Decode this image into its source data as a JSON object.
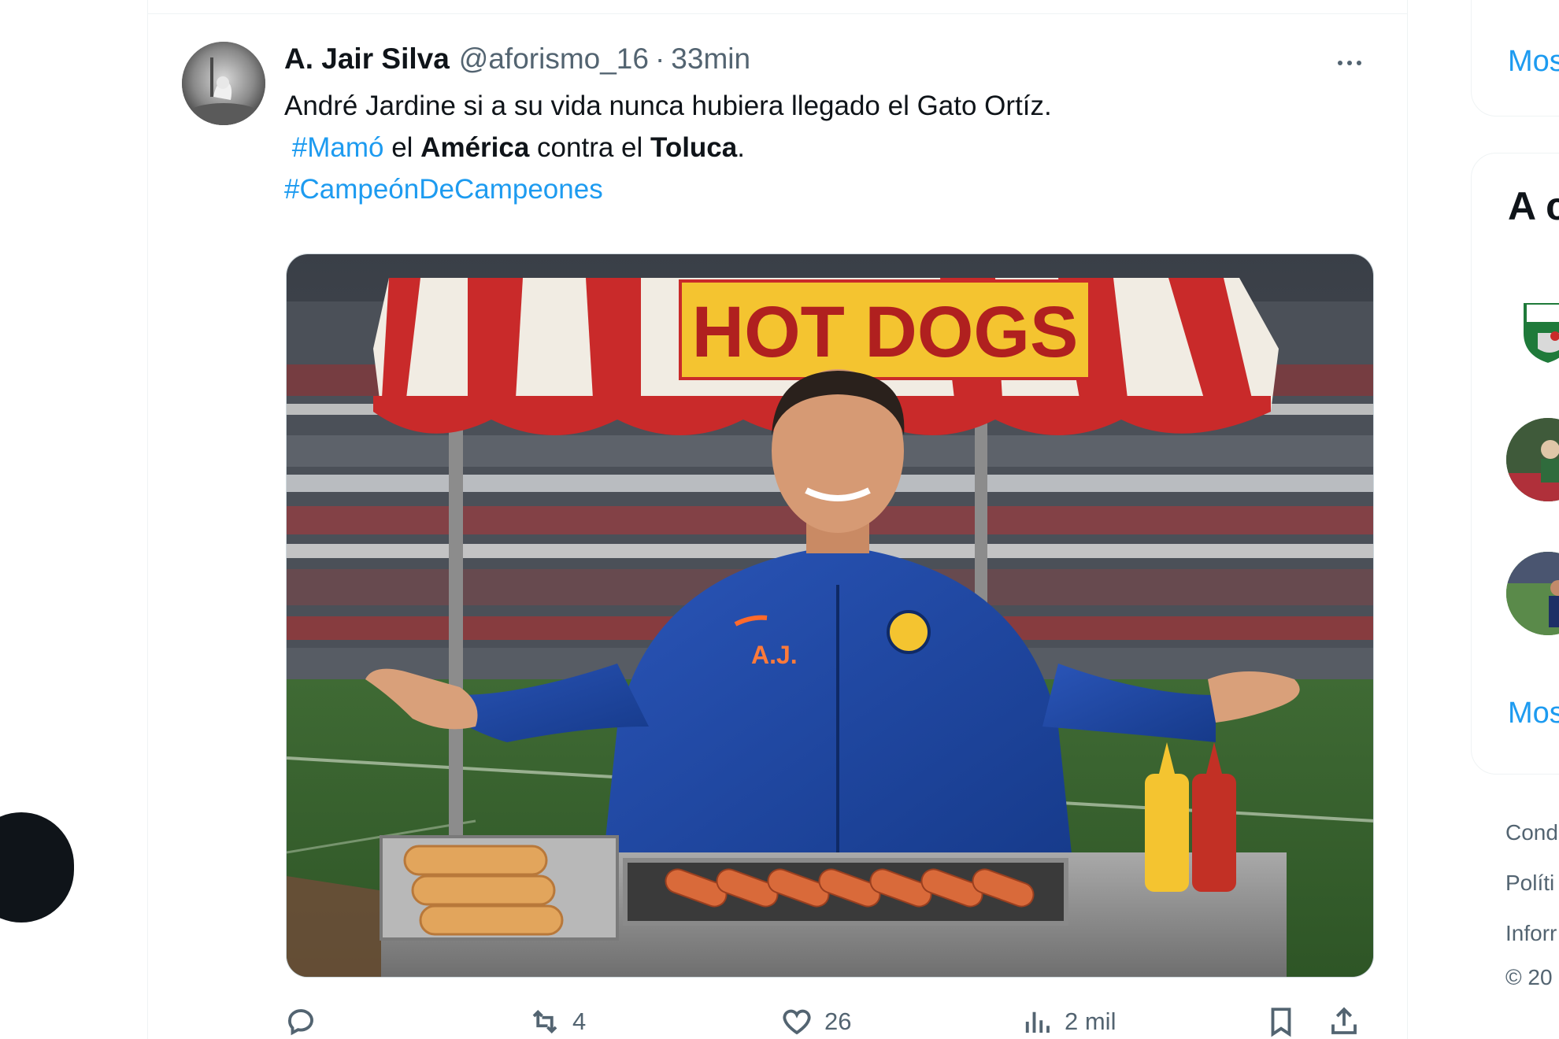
{
  "tweet": {
    "display_name": "A. Jair Silva",
    "handle": "@aforismo_16",
    "separator": "·",
    "time": "33min",
    "line1": "André Jardine si a su vida nunca hubiera llegado el Gato Ortíz.",
    "hashtag_mamo": "#Mamó",
    "word_el1": "el",
    "word_america": "América",
    "word_contra": "contra el",
    "word_toluca": "Toluca",
    "period": ".",
    "hashtag_campeon": "#CampeónDeCampeones",
    "media": {
      "sign_text": "HOT DOGS",
      "jacket_initials": "A.J."
    },
    "actions": {
      "reply_count": "",
      "repost_count": "4",
      "like_count": "26",
      "views_count": "2 mil"
    }
  },
  "sidebar": {
    "show_more_1": "Mos",
    "section_title": "A c",
    "show_more_2": "Mos",
    "footer": [
      "Cond",
      "Políti",
      "Inforr",
      "© 20"
    ]
  },
  "colors": {
    "accent": "#1d9bf0",
    "text": "#0f1419",
    "secondary": "#536471",
    "border": "#eff3f4"
  }
}
